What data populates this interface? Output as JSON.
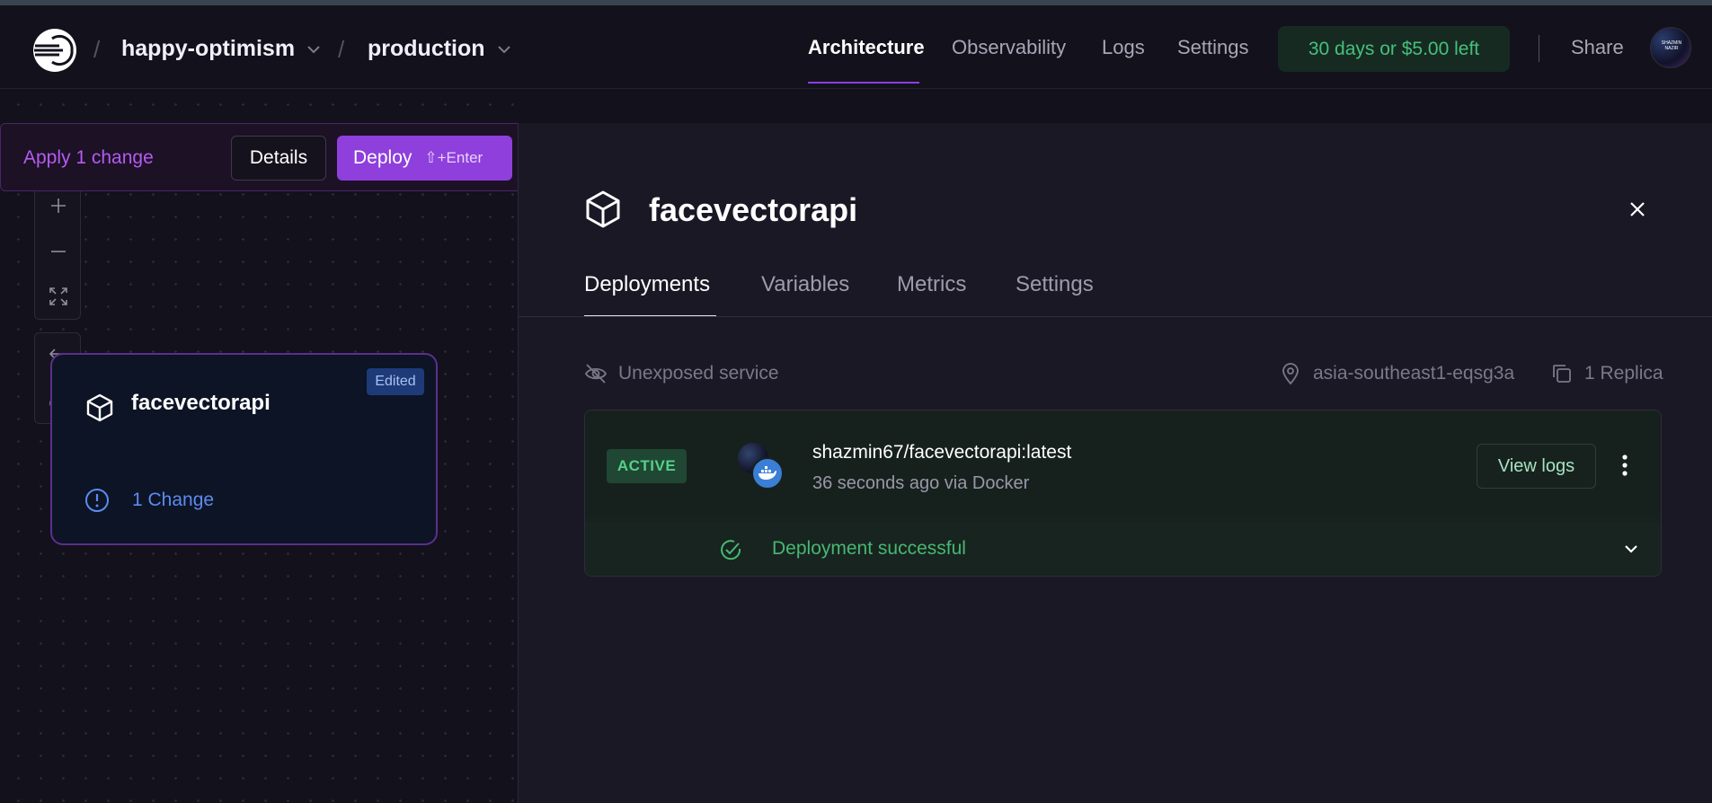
{
  "header": {
    "project": "happy-optimism",
    "environment": "production",
    "separator": "/",
    "nav": [
      "Architecture",
      "Observability",
      "Logs",
      "Settings"
    ],
    "active_nav": "Architecture",
    "trial": "30 days or $5.00 left",
    "share": "Share",
    "avatar_text": "SHAZMIN NAZIR"
  },
  "change_bar": {
    "apply": "Apply 1 change",
    "details": "Details",
    "deploy": "Deploy",
    "shortcut": "⇧+Enter"
  },
  "canvas": {
    "service": {
      "name": "facevectorapi",
      "badge": "Edited",
      "changes": "1 Change"
    }
  },
  "panel": {
    "title": "facevectorapi",
    "tabs": [
      "Deployments",
      "Variables",
      "Metrics",
      "Settings"
    ],
    "active_tab": "Deployments",
    "exposure": "Unexposed service",
    "region": "asia-southeast1-eqsg3a",
    "replicas": "1 Replica",
    "deployment": {
      "status": "ACTIVE",
      "image": "shazmin67/facevectorapi:latest",
      "meta": "36 seconds ago via Docker",
      "view_logs": "View logs",
      "result": "Deployment successful"
    }
  },
  "colors": {
    "accent": "#8e3fdc",
    "success": "#46b873",
    "link_blue": "#5c8bf0",
    "background": "#13111c"
  },
  "icons": [
    "railway-logo-icon",
    "chevron-down-icon",
    "kebab-menu-icon",
    "plus-icon",
    "minus-icon",
    "fit-view-icon",
    "undo-icon",
    "redo-icon",
    "cube-icon",
    "alert-circle-icon",
    "close-icon",
    "eye-off-icon",
    "map-pin-icon",
    "copy-icon",
    "docker-icon",
    "check-circle-icon"
  ]
}
